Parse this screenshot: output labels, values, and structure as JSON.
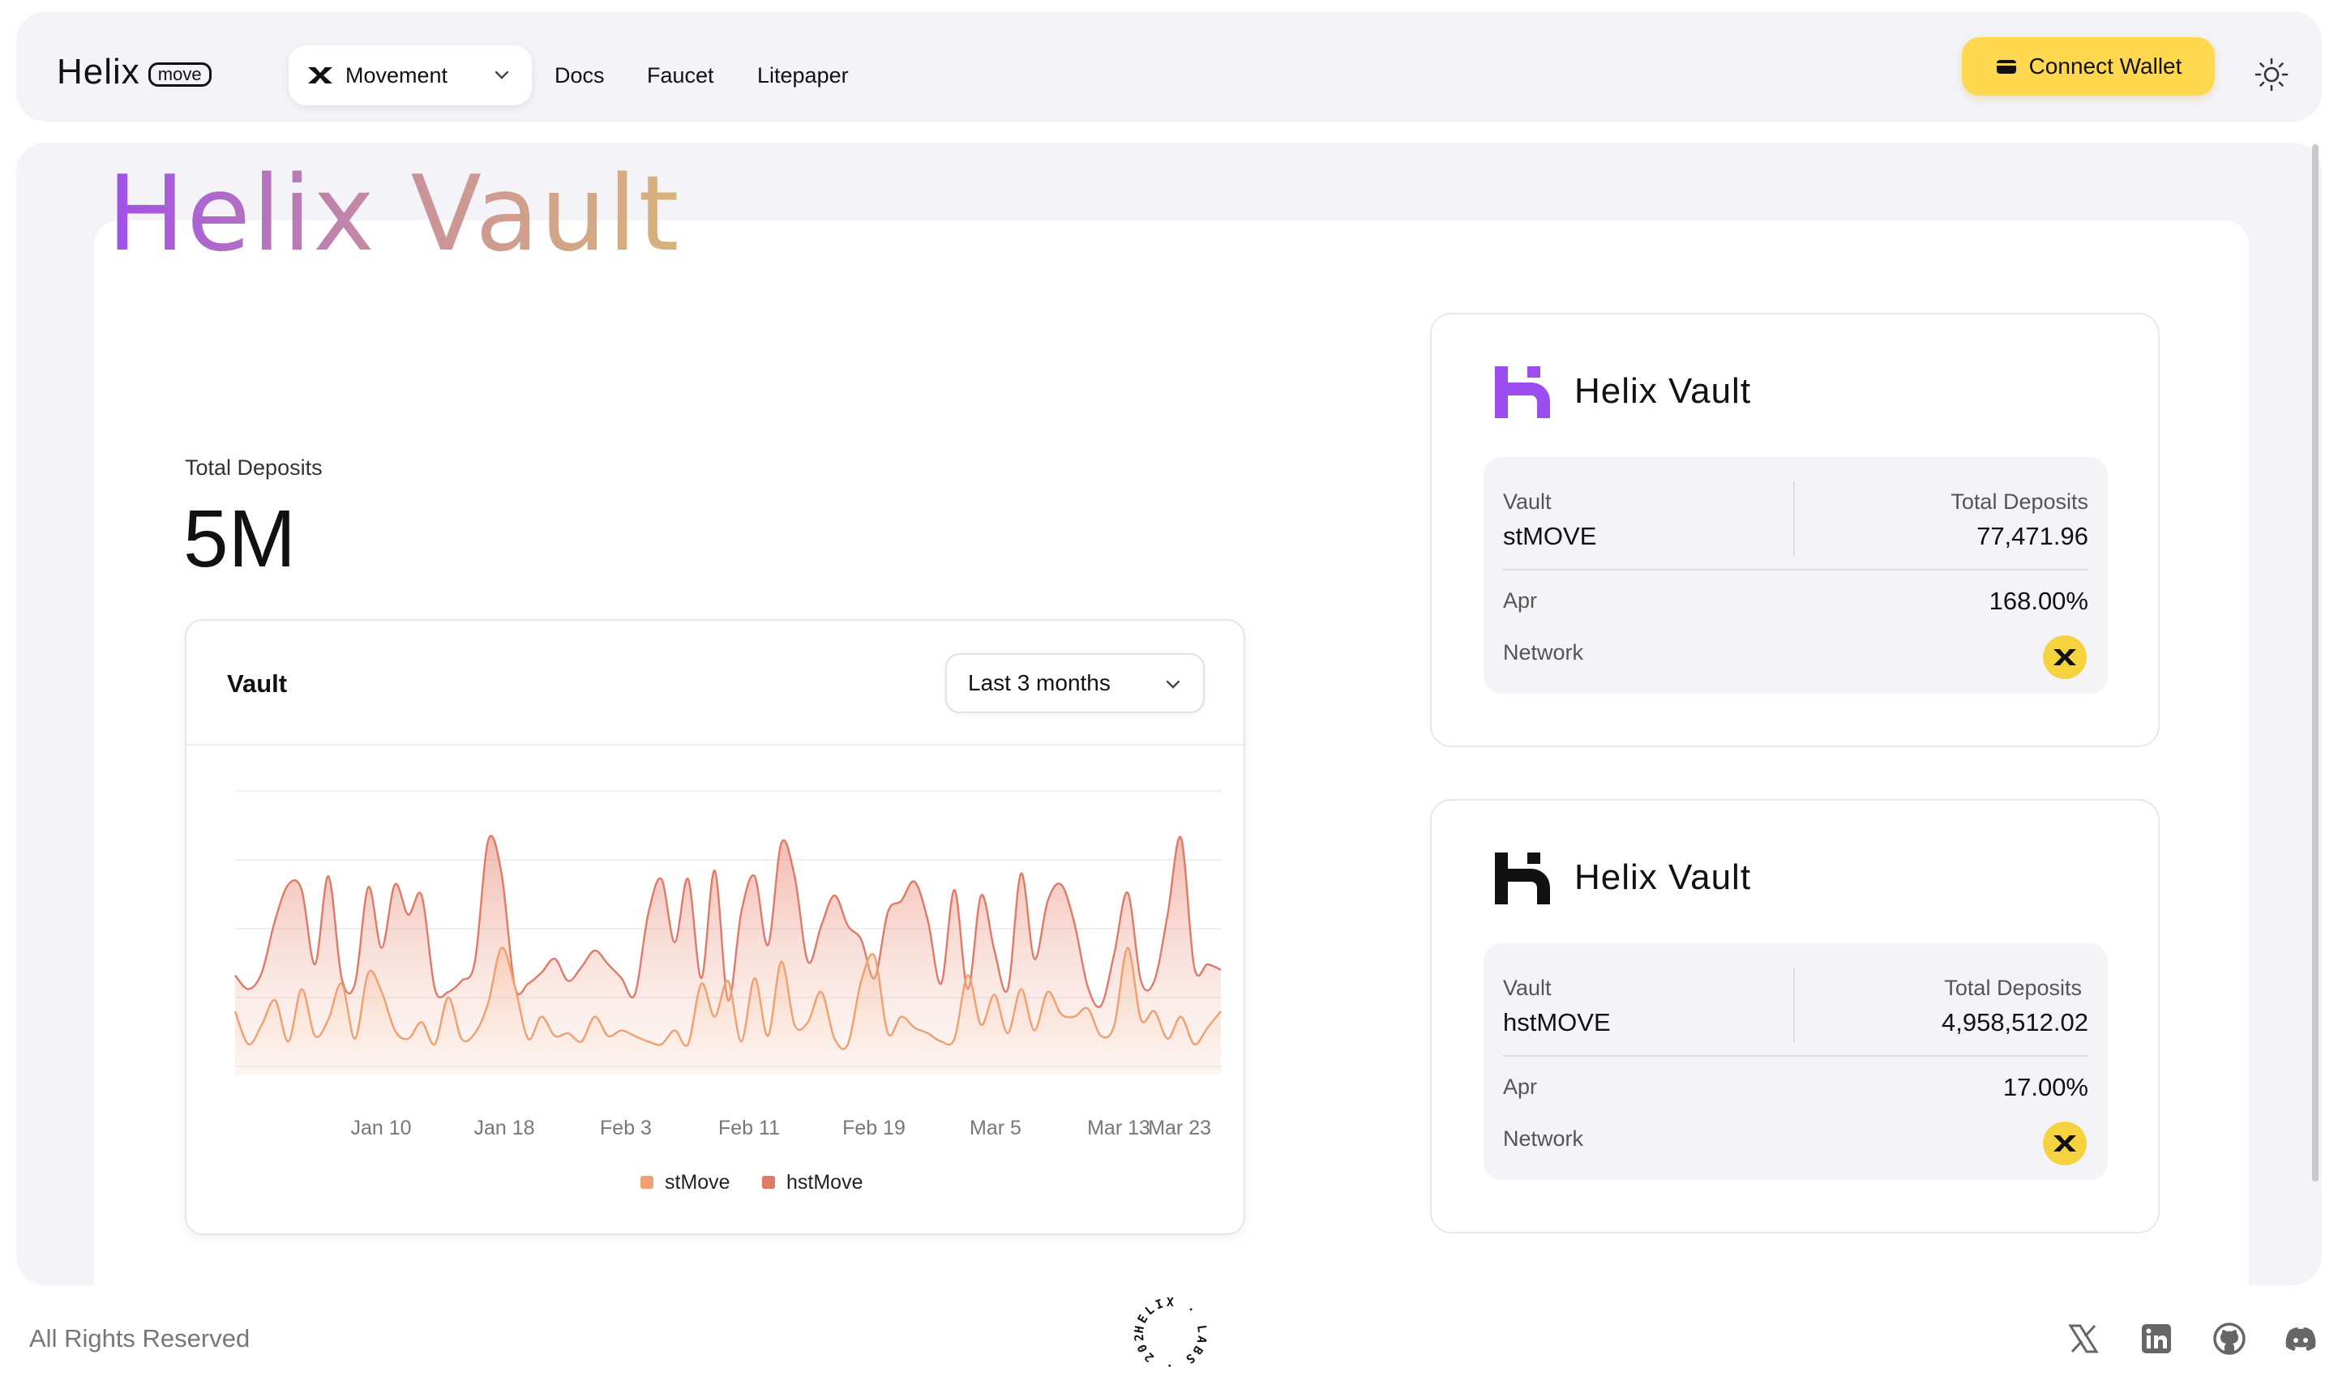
{
  "header": {
    "logo_word": "Helix",
    "logo_badge": "move",
    "network_select": {
      "value": "Movement"
    },
    "nav": [
      "Docs",
      "Faucet",
      "Litepaper"
    ],
    "connect_label": "Connect Wallet"
  },
  "hero": {
    "title": "Helix Vault",
    "total_deposits_label": "Total Deposits",
    "total_deposits_value": "5M"
  },
  "chart_card": {
    "title": "Vault",
    "range_select": {
      "value": "Last 3 months"
    }
  },
  "chart_data": {
    "type": "area",
    "x_tick_labels": [
      "Jan 10",
      "Jan 18",
      "Feb 3",
      "Feb 11",
      "Feb 19",
      "Mar 5",
      "Mar 13",
      "Mar 23"
    ],
    "legend": "bottom-center",
    "grid": true,
    "series": [
      {
        "name": "stMove",
        "color": "#f0a070",
        "values": [
          0.23,
          0.11,
          0.18,
          0.27,
          0.12,
          0.31,
          0.14,
          0.2,
          0.33,
          0.13,
          0.37,
          0.3,
          0.16,
          0.13,
          0.19,
          0.11,
          0.28,
          0.13,
          0.15,
          0.26,
          0.46,
          0.32,
          0.13,
          0.21,
          0.14,
          0.15,
          0.12,
          0.21,
          0.14,
          0.16,
          0.14,
          0.12,
          0.11,
          0.16,
          0.11,
          0.33,
          0.21,
          0.34,
          0.12,
          0.35,
          0.14,
          0.41,
          0.18,
          0.19,
          0.3,
          0.13,
          0.11,
          0.34,
          0.43,
          0.15,
          0.21,
          0.17,
          0.15,
          0.12,
          0.13,
          0.36,
          0.18,
          0.29,
          0.15,
          0.31,
          0.16,
          0.3,
          0.22,
          0.21,
          0.24,
          0.14,
          0.18,
          0.46,
          0.2,
          0.23,
          0.13,
          0.21,
          0.11,
          0.17,
          0.23
        ]
      },
      {
        "name": "hstMove",
        "color": "#e07a68",
        "values": [
          0.36,
          0.31,
          0.37,
          0.56,
          0.69,
          0.67,
          0.4,
          0.72,
          0.35,
          0.33,
          0.68,
          0.46,
          0.69,
          0.58,
          0.65,
          0.31,
          0.3,
          0.34,
          0.41,
          0.85,
          0.73,
          0.32,
          0.33,
          0.37,
          0.42,
          0.34,
          0.39,
          0.45,
          0.4,
          0.35,
          0.29,
          0.58,
          0.71,
          0.48,
          0.71,
          0.35,
          0.74,
          0.27,
          0.59,
          0.72,
          0.47,
          0.84,
          0.72,
          0.41,
          0.54,
          0.65,
          0.54,
          0.49,
          0.35,
          0.59,
          0.63,
          0.7,
          0.56,
          0.33,
          0.67,
          0.31,
          0.65,
          0.45,
          0.31,
          0.73,
          0.42,
          0.63,
          0.69,
          0.55,
          0.32,
          0.25,
          0.44,
          0.66,
          0.34,
          0.34,
          0.58,
          0.86,
          0.39,
          0.4,
          0.38
        ]
      }
    ]
  },
  "vaults": [
    {
      "name": "Helix Vault",
      "logo_color": "#9b4df0",
      "vault_label": "Vault",
      "vault_value": "stMOVE",
      "deposits_label": "Total Deposits",
      "deposits_value": "77,471.96",
      "apr_label": "Apr",
      "apr_value": "168.00%",
      "network_label": "Network"
    },
    {
      "name": "Helix Vault",
      "logo_color": "#111111",
      "vault_label": "Vault",
      "vault_value": "hstMOVE",
      "deposits_label": "Total Deposits",
      "deposits_value": "4,958,512.02",
      "apr_label": "Apr",
      "apr_value": "17.00%",
      "network_label": "Network"
    }
  ],
  "footer": {
    "rights": "All Rights Reserved",
    "seal_text": "HELIX · LABS · 2025 ·",
    "social_icons": [
      "x-icon",
      "linkedin-icon",
      "github-icon",
      "discord-icon"
    ]
  },
  "colors": {
    "accent_yellow": "#ffd84f",
    "panel_bg": "#f4f3f7",
    "network_badge": "#f4d33e"
  }
}
